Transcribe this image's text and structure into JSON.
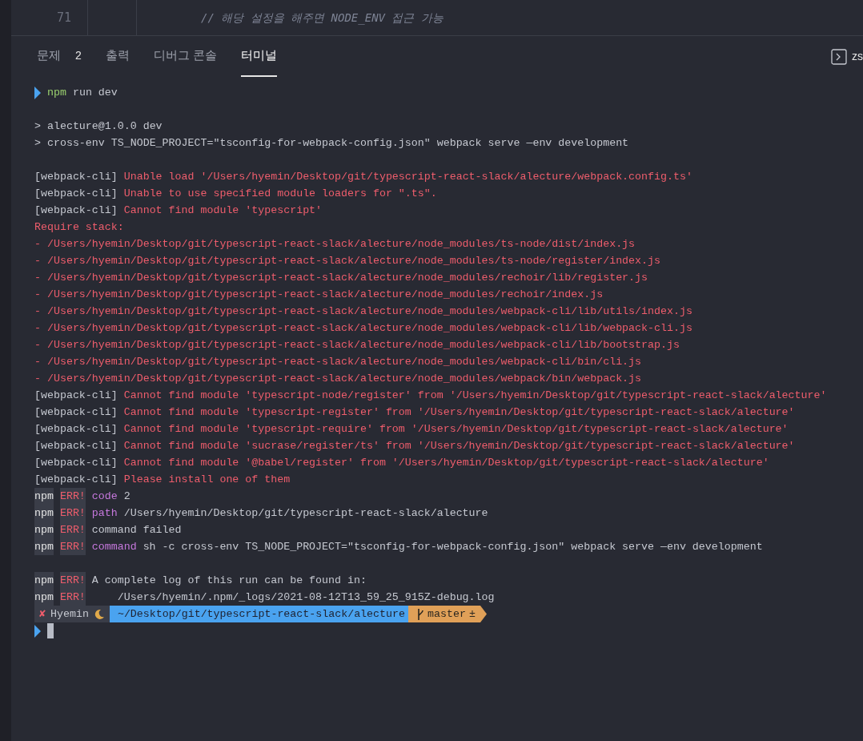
{
  "editor": {
    "line_number": "71",
    "code": "// 해당 설정을 해주면 NODE_ENV 접근 가능"
  },
  "panel_tabs": [
    {
      "label": "문제",
      "badge": "2",
      "selected": false
    },
    {
      "label": "출력",
      "selected": false
    },
    {
      "label": "디버그 콘솔",
      "selected": false
    },
    {
      "label": "터미널",
      "selected": true
    }
  ],
  "terminal_label": "zs",
  "terminal": {
    "lines": [
      {
        "kind": "command",
        "segments": [
          {
            "kind": "program",
            "text": "npm"
          },
          {
            "kind": "plain",
            "text": " run dev"
          }
        ]
      },
      {
        "kind": "blank"
      },
      {
        "kind": "output",
        "segments": [
          {
            "kind": "plain",
            "text": "> alecture@1.0.0 dev"
          }
        ]
      },
      {
        "kind": "output",
        "segments": [
          {
            "kind": "plain",
            "text": "> cross-env TS_NODE_PROJECT=\"tsconfig-for-webpack-config.json\" webpack serve —env development"
          }
        ]
      },
      {
        "kind": "blank"
      },
      {
        "kind": "output",
        "segments": [
          {
            "kind": "plain",
            "text": "[webpack-cli] "
          },
          {
            "kind": "error",
            "text": "Unable load '/Users/hyemin/Desktop/git/typescript-react-slack/alecture/webpack.config.ts'"
          }
        ]
      },
      {
        "kind": "output",
        "segments": [
          {
            "kind": "plain",
            "text": "[webpack-cli] "
          },
          {
            "kind": "error",
            "text": "Unable to use specified module loaders for \".ts\"."
          }
        ]
      },
      {
        "kind": "output",
        "segments": [
          {
            "kind": "plain",
            "text": "[webpack-cli] "
          },
          {
            "kind": "error",
            "text": "Cannot find module 'typescript'"
          }
        ]
      },
      {
        "kind": "output",
        "segments": [
          {
            "kind": "error",
            "text": "Require stack:"
          }
        ]
      },
      {
        "kind": "output",
        "segments": [
          {
            "kind": "error",
            "text": "- /Users/hyemin/Desktop/git/typescript-react-slack/alecture/node_modules/ts-node/dist/index.js"
          }
        ]
      },
      {
        "kind": "output",
        "segments": [
          {
            "kind": "error",
            "text": "- /Users/hyemin/Desktop/git/typescript-react-slack/alecture/node_modules/ts-node/register/index.js"
          }
        ]
      },
      {
        "kind": "output",
        "segments": [
          {
            "kind": "error",
            "text": "- /Users/hyemin/Desktop/git/typescript-react-slack/alecture/node_modules/rechoir/lib/register.js"
          }
        ]
      },
      {
        "kind": "output",
        "segments": [
          {
            "kind": "error",
            "text": "- /Users/hyemin/Desktop/git/typescript-react-slack/alecture/node_modules/rechoir/index.js"
          }
        ]
      },
      {
        "kind": "output",
        "segments": [
          {
            "kind": "error",
            "text": "- /Users/hyemin/Desktop/git/typescript-react-slack/alecture/node_modules/webpack-cli/lib/utils/index.js"
          }
        ]
      },
      {
        "kind": "output",
        "segments": [
          {
            "kind": "error",
            "text": "- /Users/hyemin/Desktop/git/typescript-react-slack/alecture/node_modules/webpack-cli/lib/webpack-cli.js"
          }
        ]
      },
      {
        "kind": "output",
        "segments": [
          {
            "kind": "error",
            "text": "- /Users/hyemin/Desktop/git/typescript-react-slack/alecture/node_modules/webpack-cli/lib/bootstrap.js"
          }
        ]
      },
      {
        "kind": "output",
        "segments": [
          {
            "kind": "error",
            "text": "- /Users/hyemin/Desktop/git/typescript-react-slack/alecture/node_modules/webpack-cli/bin/cli.js"
          }
        ]
      },
      {
        "kind": "output",
        "segments": [
          {
            "kind": "error",
            "text": "- /Users/hyemin/Desktop/git/typescript-react-slack/alecture/node_modules/webpack/bin/webpack.js"
          }
        ]
      },
      {
        "kind": "output",
        "segments": [
          {
            "kind": "plain",
            "text": "[webpack-cli] "
          },
          {
            "kind": "error",
            "text": "Cannot find module 'typescript-node/register' from '/Users/hyemin/Desktop/git/typescript-react-slack/alecture'"
          }
        ]
      },
      {
        "kind": "output",
        "segments": [
          {
            "kind": "plain",
            "text": "[webpack-cli] "
          },
          {
            "kind": "error",
            "text": "Cannot find module 'typescript-register' from '/Users/hyemin/Desktop/git/typescript-react-slack/alecture'"
          }
        ]
      },
      {
        "kind": "output",
        "segments": [
          {
            "kind": "plain",
            "text": "[webpack-cli] "
          },
          {
            "kind": "error",
            "text": "Cannot find module 'typescript-require' from '/Users/hyemin/Desktop/git/typescript-react-slack/alecture'"
          }
        ]
      },
      {
        "kind": "output",
        "segments": [
          {
            "kind": "plain",
            "text": "[webpack-cli] "
          },
          {
            "kind": "error",
            "text": "Cannot find module 'sucrase/register/ts' from '/Users/hyemin/Desktop/git/typescript-react-slack/alecture'"
          }
        ]
      },
      {
        "kind": "output",
        "segments": [
          {
            "kind": "plain",
            "text": "[webpack-cli] "
          },
          {
            "kind": "error",
            "text": "Cannot find module '@babel/register' from '/Users/hyemin/Desktop/git/typescript-react-slack/alecture'"
          }
        ]
      },
      {
        "kind": "output",
        "segments": [
          {
            "kind": "plain",
            "text": "[webpack-cli] "
          },
          {
            "kind": "error",
            "text": "Please install one of them"
          }
        ]
      },
      {
        "kind": "output",
        "segments": [
          {
            "kind": "npm",
            "text": "npm"
          },
          {
            "kind": "err",
            "text": "ERR!"
          },
          {
            "kind": "keyword",
            "text": "code"
          },
          {
            "kind": "plain",
            "text": "2"
          }
        ]
      },
      {
        "kind": "output",
        "segments": [
          {
            "kind": "npm",
            "text": "npm"
          },
          {
            "kind": "err",
            "text": "ERR!"
          },
          {
            "kind": "keyword",
            "text": "path"
          },
          {
            "kind": "plain",
            "text": "/Users/hyemin/Desktop/git/typescript-react-slack/alecture"
          }
        ]
      },
      {
        "kind": "output",
        "segments": [
          {
            "kind": "npm",
            "text": "npm"
          },
          {
            "kind": "err",
            "text": "ERR!"
          },
          {
            "kind": "plain",
            "text": "command failed"
          }
        ]
      },
      {
        "kind": "output",
        "segments": [
          {
            "kind": "npm",
            "text": "npm"
          },
          {
            "kind": "err",
            "text": "ERR!"
          },
          {
            "kind": "keyword",
            "text": "command"
          },
          {
            "kind": "plain",
            "text": "sh -c cross-env TS_NODE_PROJECT=\"tsconfig-for-webpack-config.json\" webpack serve —env development"
          }
        ]
      },
      {
        "kind": "blank"
      },
      {
        "kind": "output",
        "segments": [
          {
            "kind": "npm",
            "text": "npm"
          },
          {
            "kind": "err",
            "text": "ERR!"
          },
          {
            "kind": "plain",
            "text": "A complete log of this run can be found in:"
          }
        ]
      },
      {
        "kind": "output",
        "segments": [
          {
            "kind": "npm",
            "text": "npm"
          },
          {
            "kind": "err",
            "text": "ERR!"
          },
          {
            "kind": "plain",
            "text": "    /Users/hyemin/.npm/_logs/2021-08-12T13_59_25_915Z-debug.log"
          }
        ]
      }
    ],
    "prompt": {
      "status_mark": "✘",
      "user": "Hyemin",
      "path": "~/Desktop/git/typescript-react-slack/alecture",
      "branch": "master",
      "branch_status": "±"
    }
  }
}
